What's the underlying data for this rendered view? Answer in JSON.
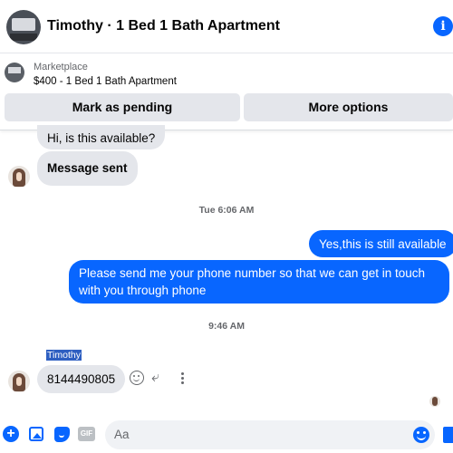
{
  "header": {
    "title": "Timothy · 1 Bed 1 Bath Apartment",
    "info_icon": "info-icon",
    "info_glyph": "i"
  },
  "marketplace": {
    "label": "Marketplace",
    "item": "$400 - 1 Bed 1 Bath Apartment",
    "buttons": {
      "pending": "Mark as pending",
      "more": "More options"
    }
  },
  "messages": [
    {
      "direction": "incoming",
      "text": "Hi, is this available?"
    },
    {
      "direction": "incoming",
      "text": "Message sent"
    },
    {
      "direction": "outgoing",
      "text": "Yes,this is still available"
    },
    {
      "direction": "outgoing",
      "text": "Please send me your phone  number so that we can get in touch with you through phone"
    },
    {
      "direction": "incoming",
      "sender": "Timothy",
      "text": "8144490805"
    }
  ],
  "timestamps": [
    "Tue 6:06 AM",
    "9:46 AM"
  ],
  "composer": {
    "placeholder": "Aa",
    "icons": [
      "plus-icon",
      "photo-icon",
      "sticker-icon",
      "gif-icon",
      "emoji-icon",
      "like-icon"
    ],
    "gif_label": "GIF",
    "plus_glyph": "+"
  },
  "colors": {
    "accent": "#0866ff",
    "incoming_bubble": "#e4e6eb",
    "button_bg": "#e4e6eb",
    "timestamp_text": "#65676b"
  }
}
